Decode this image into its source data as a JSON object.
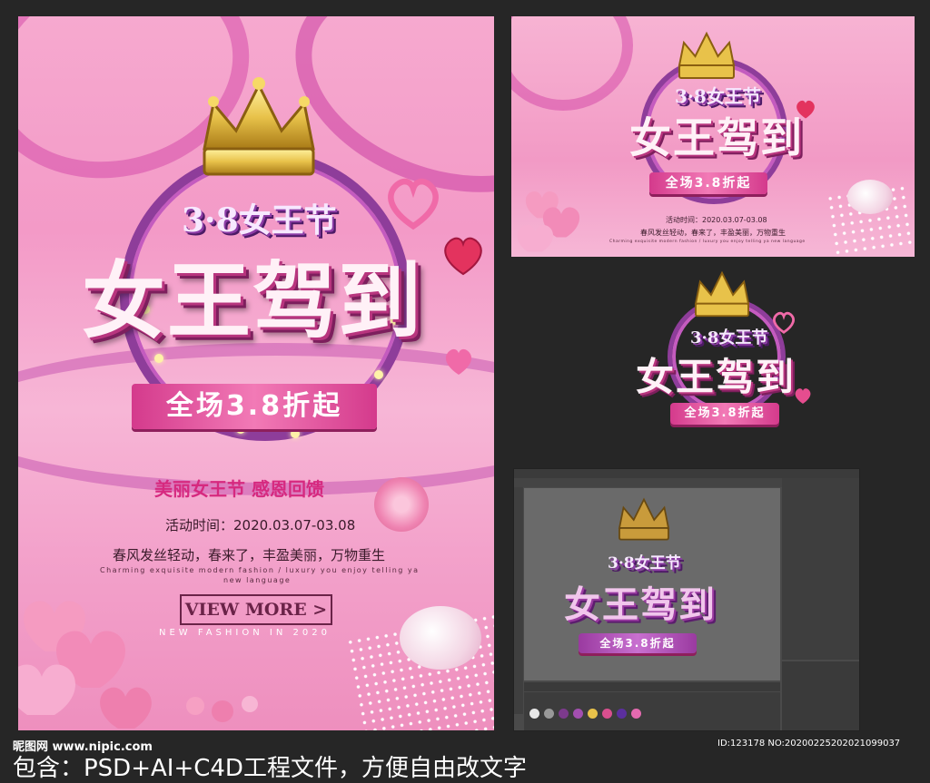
{
  "poster": {
    "subtitle_top": "3·8女王节",
    "title": "女王驾到",
    "banner": "全场3.8折起",
    "tagline": "美丽女王节 感恩回馈",
    "event_time": "活动时间：2020.03.07-03.08",
    "slogan": "春风发丝轻动，春来了，丰盈美丽，万物重生",
    "english_line1": "Charming exquisite modern fashion / luxury you enjoy telling ya",
    "english_line2": "new language",
    "view_more": "VIEW MORE >",
    "new_fashion": "NEW FASHION IN 2020"
  },
  "landscape": {
    "subtitle_top": "3·8女王节",
    "title": "女王驾到",
    "banner": "全场3.8折起",
    "event_time": "活动时间：2020.03.07-03.08",
    "slogan": "春风发丝轻动，春来了，丰盈美丽，万物重生",
    "english_line": "Charming exquisite modern fashion / luxury you enjoy telling ya new language"
  },
  "logo3d": {
    "subtitle_top": "3·8女王节",
    "title": "女王驾到",
    "banner": "全场3.8折起"
  },
  "c4d": {
    "viewport_subtitle": "3·8女王节",
    "viewport_title": "女王驾到",
    "viewport_banner": "全场3.8折起"
  },
  "footer": {
    "site_logo": "昵图网 www.nipic.com",
    "id_text": "ID:123178 NO:20200225202021099037",
    "caption": "包含：PSD+AI+C4D工程文件，方便自由改文字"
  },
  "colors": {
    "background": "#262626",
    "pink_main": "#f39ac7",
    "magenta_accent": "#d43a8c",
    "purple_ring": "#8e3d9a",
    "gold": "#e8c24a"
  }
}
